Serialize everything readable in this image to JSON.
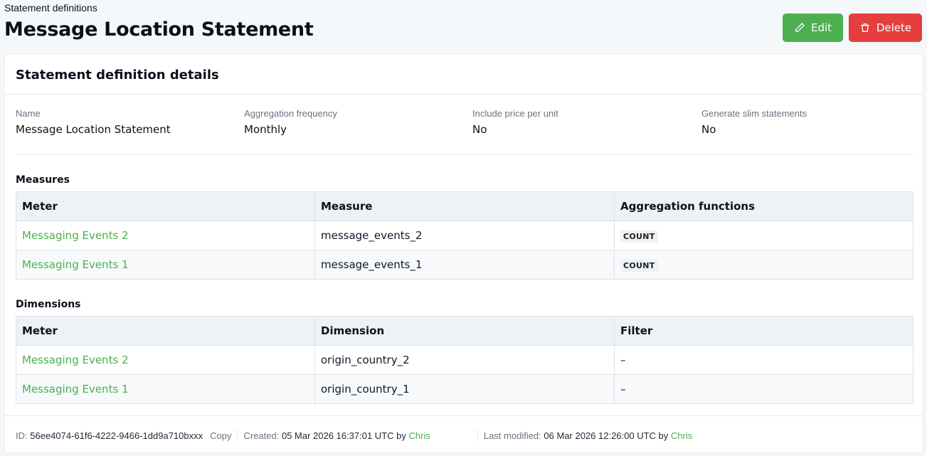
{
  "header": {
    "breadcrumb": "Statement definitions",
    "title": "Message Location Statement",
    "edit_label": "Edit",
    "delete_label": "Delete"
  },
  "details": {
    "card_title": "Statement definition details",
    "fields": [
      {
        "label": "Name",
        "value": "Message Location Statement"
      },
      {
        "label": "Aggregation frequency",
        "value": "Monthly"
      },
      {
        "label": "Include price per unit",
        "value": "No"
      },
      {
        "label": "Generate slim statements",
        "value": "No"
      }
    ]
  },
  "measures": {
    "title": "Measures",
    "headers": [
      "Meter",
      "Measure",
      "Aggregation functions"
    ],
    "rows": [
      {
        "meter": "Messaging Events 2",
        "measure": "message_events_2",
        "func": "COUNT"
      },
      {
        "meter": "Messaging Events 1",
        "measure": "message_events_1",
        "func": "COUNT"
      }
    ]
  },
  "dimensions": {
    "title": "Dimensions",
    "headers": [
      "Meter",
      "Dimension",
      "Filter"
    ],
    "rows": [
      {
        "meter": "Messaging Events 2",
        "dimension": "origin_country_2",
        "filter": "–"
      },
      {
        "meter": "Messaging Events 1",
        "dimension": "origin_country_1",
        "filter": "–"
      }
    ]
  },
  "footer": {
    "id_label": "ID:",
    "id_value": "56ee4074-61f6-4222-9466-1dd9a710bxxx",
    "copy_label": "Copy",
    "created_label": "Created:",
    "created_value": "05 Mar 2026 16:37:01 UTC by",
    "created_by": "Chris",
    "modified_label": "Last modified:",
    "modified_value": "06 Mar 2026 12:26:00 UTC by",
    "modified_by": "Chris"
  },
  "colors": {
    "accent_green": "#4caf50",
    "danger_red": "#e53e3e"
  }
}
